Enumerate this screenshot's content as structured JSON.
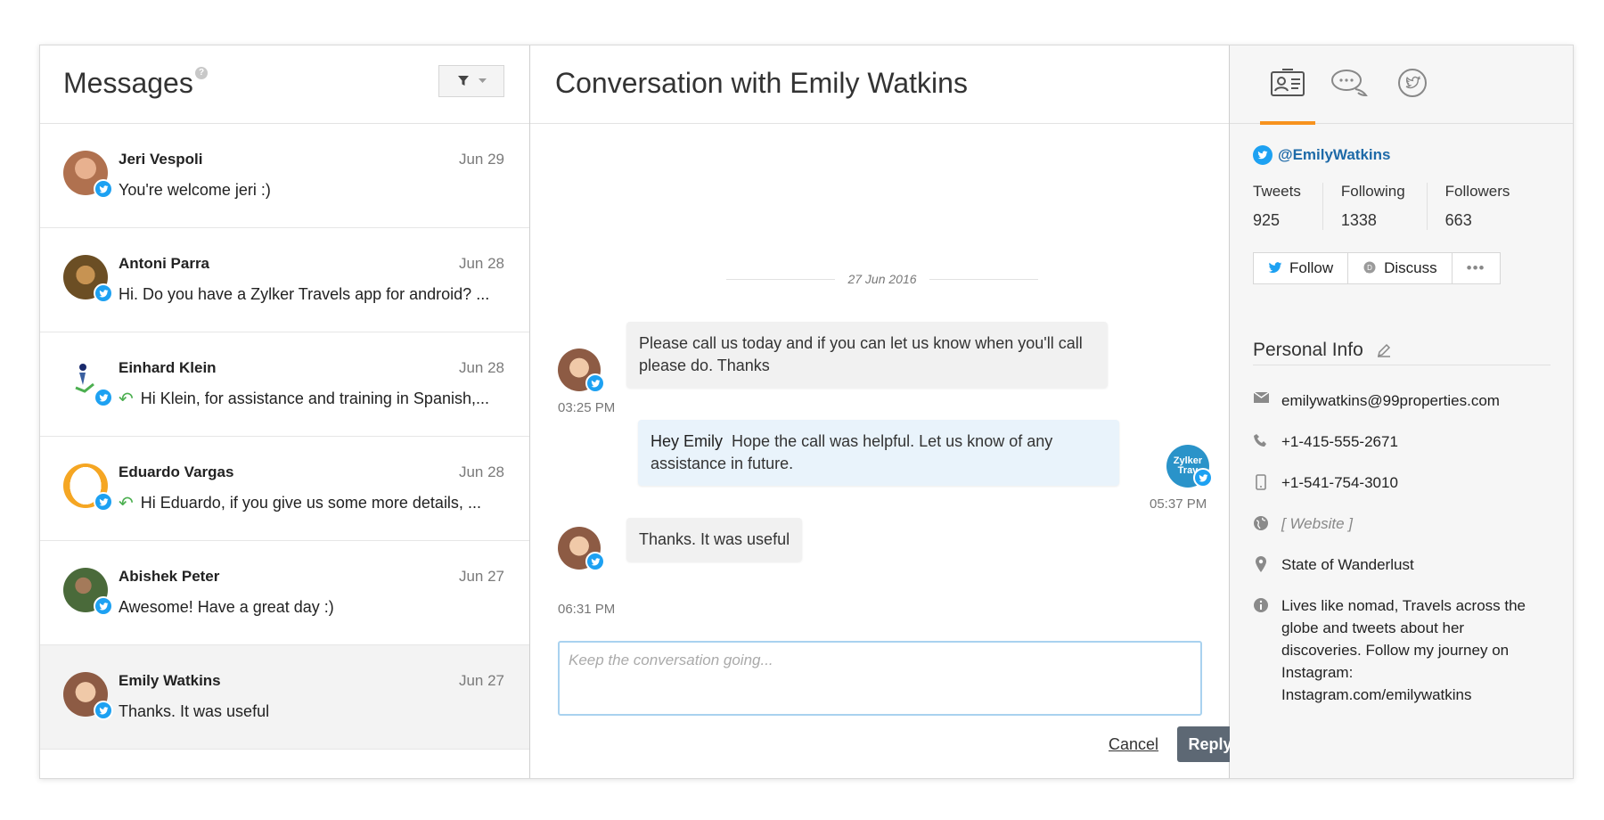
{
  "messages_panel": {
    "title": "Messages",
    "help_glyph": "?",
    "items": [
      {
        "name": "Jeri Vespoli",
        "date": "Jun 29",
        "preview": "You're welcome jeri :)",
        "replied": false,
        "avatar_color": "#b0714f"
      },
      {
        "name": "Antoni Parra",
        "date": "Jun 28",
        "preview": "Hi. Do you have a Zylker Travels app for android? ...",
        "replied": false,
        "avatar_color": "#6b4e24"
      },
      {
        "name": "Einhard Klein",
        "date": "Jun 28",
        "preview": "Hi Klein, for assistance and training in Spanish,...",
        "replied": true,
        "avatar_color": "#ffffff"
      },
      {
        "name": "Eduardo Vargas",
        "date": "Jun 28",
        "preview": "Hi Eduardo, if you give us some more details, ...",
        "replied": true,
        "avatar_color": "#f5a623"
      },
      {
        "name": "Abishek Peter",
        "date": "Jun 27",
        "preview": "Awesome! Have a great day :)",
        "replied": false,
        "avatar_color": "#4a6a3a"
      },
      {
        "name": "Emily Watkins",
        "date": "Jun 27",
        "preview": "Thanks. It was useful",
        "replied": false,
        "avatar_color": "#8d5b44"
      }
    ]
  },
  "conversation": {
    "title": "Conversation with Emily Watkins",
    "date_separator": "27 Jun 2016",
    "messages": [
      {
        "text": "Please call us today and if you can let us know when you'll call please do. Thanks",
        "time": "03:25 PM"
      },
      {
        "sender": "Hey Emily",
        "text": "Hope the call was helpful. Let us know of any assistance in future.",
        "time": "05:37 PM"
      },
      {
        "text": "Thanks. It was useful",
        "time": "06:31 PM"
      }
    ],
    "composer_placeholder": "Keep the conversation going...",
    "cancel_label": "Cancel",
    "reply_label": "Reply",
    "brand_avatar_text": "Zylker Trav"
  },
  "profile": {
    "handle": "@EmilyWatkins",
    "stats": [
      {
        "label": "Tweets",
        "value": "925"
      },
      {
        "label": "Following",
        "value": "1338"
      },
      {
        "label": "Followers",
        "value": "663"
      }
    ],
    "follow_label": "Follow",
    "discuss_label": "Discuss",
    "more_label": "•••",
    "personal_info_title": "Personal Info",
    "email": "emilywatkins@99properties.com",
    "phone": "+1-415-555-2671",
    "mobile": "+1-541-754-3010",
    "website": "[ Website ]",
    "location": "State of Wanderlust",
    "bio": "Lives like nomad, Travels across the globe and tweets about her discoveries. Follow my journey on Instagram: Instagram.com/emilywatkins"
  },
  "colors": {
    "accent_orange": "#f7921e",
    "twitter_blue": "#1da1f2",
    "reply_button": "#5d6874",
    "outgoing_bubble": "#e9f3fb"
  }
}
